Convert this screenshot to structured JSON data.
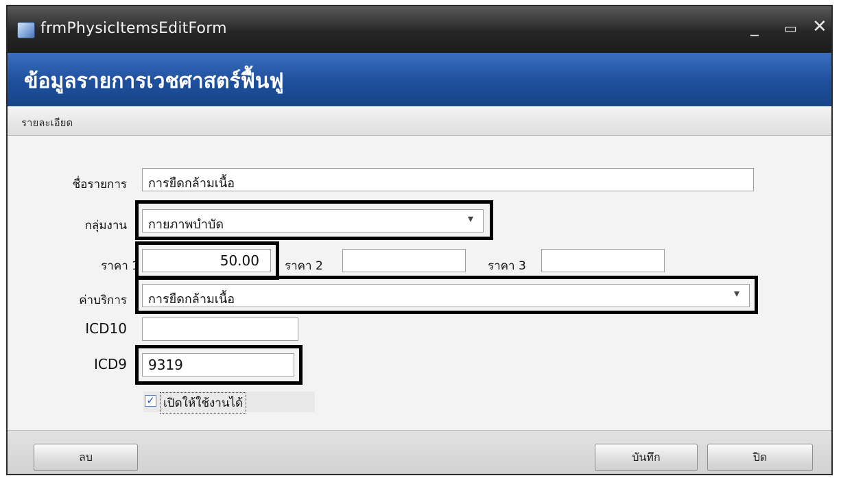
{
  "window": {
    "title": "frmPhysicItemsEditForm",
    "minimize_glyph": "_",
    "maximize_glyph": "▭",
    "close_glyph": "✕"
  },
  "header": {
    "title": "ข้อมูลรายการเวชศาสตร์ฟื้นฟู"
  },
  "section": {
    "label": "รายละเอียด"
  },
  "form": {
    "item_name_label": "ชื่อรายการ",
    "item_name_value": "การยืดกล้ามเนื้อ",
    "work_group_label": "กลุ่มงาน",
    "work_group_value": "กายภาพบำบัด",
    "price1_label": "ราคา 1",
    "price1_value": "50.00",
    "price2_label": "ราคา 2",
    "price2_value": "",
    "price3_label": "ราคา 3",
    "price3_value": "",
    "service_label": "ค่าบริการ",
    "service_value": "การยืดกล้ามเนื้อ",
    "icd10_label": "ICD10",
    "icd10_value": "",
    "icd9_label": "ICD9",
    "icd9_value": "9319",
    "enabled_label": "เปิดให้ใช้งานได้",
    "enabled_checked": true,
    "dropdown_glyph": "▾",
    "check_glyph": "✓"
  },
  "footer": {
    "delete_label": "ลบ",
    "save_label": "บันทึก",
    "close_label": "ปิด"
  },
  "icons": [
    "app-icon",
    "minimize-icon",
    "maximize-icon",
    "close-icon",
    "dropdown-arrow-icon",
    "checkmark-icon"
  ]
}
